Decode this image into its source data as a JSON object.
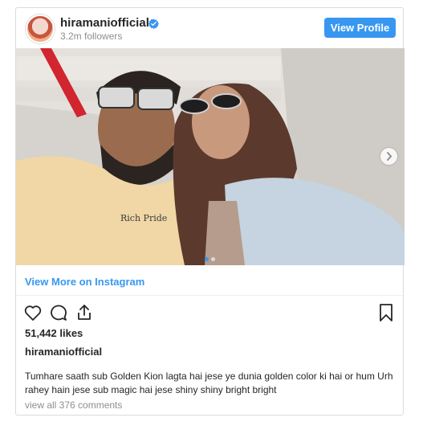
{
  "post": {
    "username": "hiramaniofficial",
    "followers": "3.2m followers",
    "view_profile_label": "View Profile",
    "view_more_label": "View More on Instagram",
    "likes": "51,442 likes",
    "caption_user": "hiramaniofficial",
    "caption_text": "Tumhare saath sub Golden Kion lagta hai jese ye dunia golden color ki hai or hum Urh rahey hain jese sub magic hai jese shiny shiny bright bright",
    "comments_link": "view all 376 comments",
    "carousel_index": 1,
    "carousel_total": 2
  },
  "colors": {
    "accent": "#3897f0",
    "text": "#262626",
    "muted": "#8e8e8e",
    "border": "#dbdbdb"
  },
  "icons": {
    "verified": "verified-badge-icon",
    "like": "heart-icon",
    "comment": "comment-bubble-icon",
    "share": "share-icon",
    "save": "bookmark-icon",
    "next": "chevron-right-icon"
  }
}
